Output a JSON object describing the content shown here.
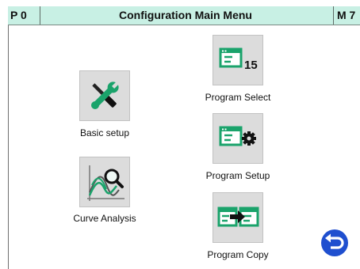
{
  "header": {
    "program_code": "P 0",
    "title": "Configuration Main Menu",
    "mode_code": "M 7"
  },
  "menu": {
    "basic_setup": "Basic setup",
    "curve_analysis": "Curve Analysis",
    "program_select": "Program Select",
    "program_select_number": "15",
    "program_setup": "Program Setup",
    "program_copy": "Program Copy"
  },
  "icons": {
    "basic_setup": "wrench-screwdriver-icon",
    "curve_analysis": "curve-magnifier-icon",
    "program_select": "window-number-icon",
    "program_setup": "window-gear-icon",
    "program_copy": "window-copy-arrow-icon",
    "back": "back-arrow-icon"
  },
  "colors": {
    "header_bg": "#c8f0e4",
    "tile_bg": "#dcdcdc",
    "accent_green": "#1aa36b",
    "back_blue": "#1f4fcf"
  }
}
